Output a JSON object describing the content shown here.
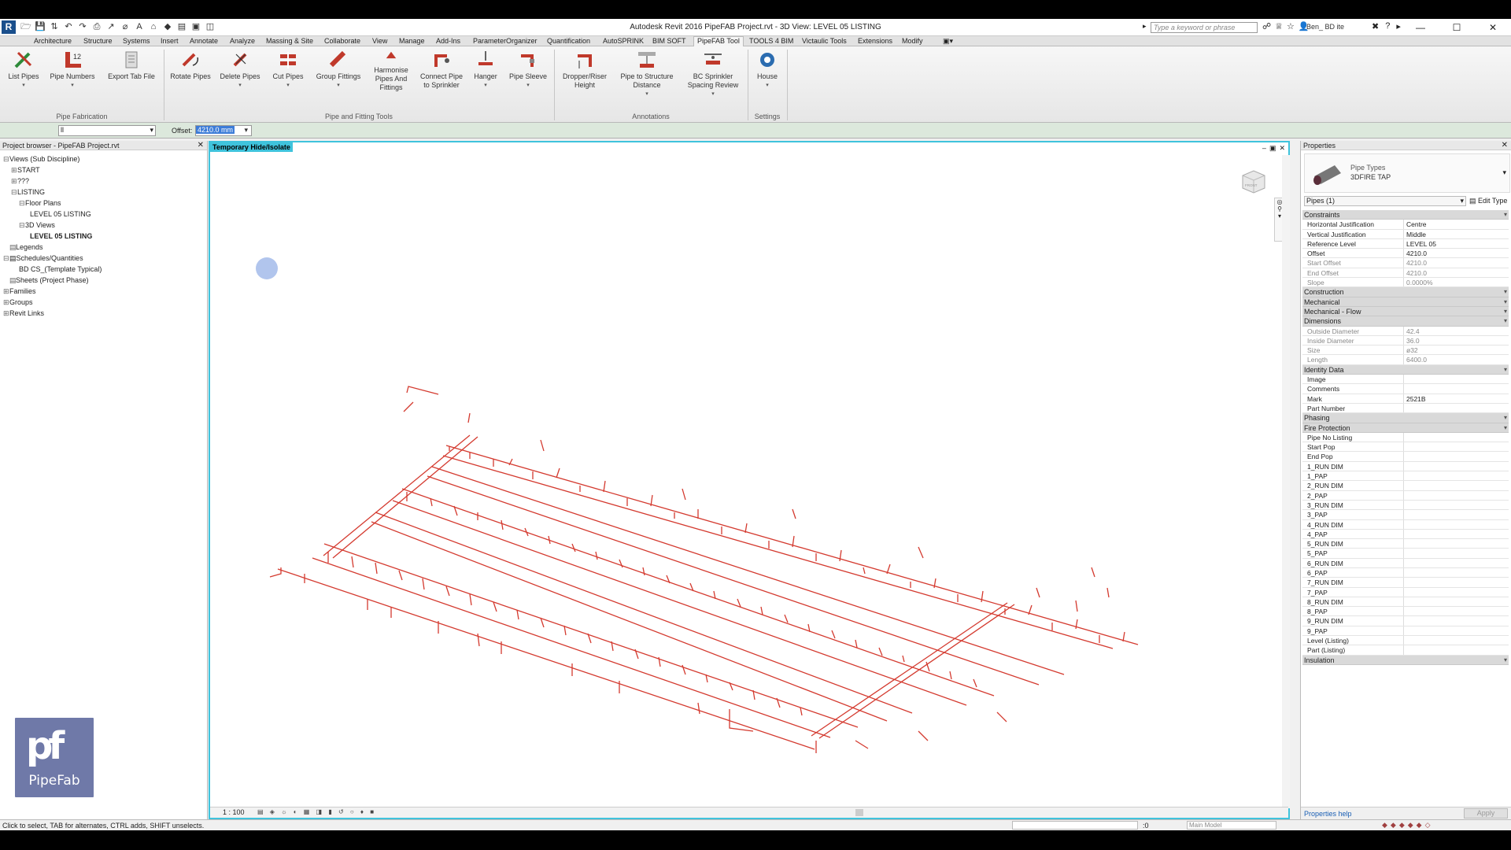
{
  "titlebar": {
    "window_title": "Autodesk Revit 2016     PipeFAB Project.rvt - 3D View: LEVEL 05 LISTING",
    "search_placeholder": "Type a keyword or phrase",
    "user_name": "Ben_ BD ite",
    "min": "—",
    "max": "☐",
    "close": "✕"
  },
  "ribbon_tabs": [
    "Architecture",
    "Structure",
    "Systems",
    "Insert",
    "Annotate",
    "Analyze",
    "Massing & Site",
    "Collaborate",
    "View",
    "Manage",
    "Add-Ins",
    "ParameterOrganizer",
    "Quantification",
    "AutoSPRINK",
    "BIM SOFT",
    "PipeFAB Tool",
    "TOOLS 4 BIM",
    "Victaulic Tools",
    "Extensions",
    "Modify"
  ],
  "active_tab": "PipeFAB Tool",
  "ribbon": {
    "buttons": [
      {
        "label": "List Pipes"
      },
      {
        "label": "Pipe Numbers"
      },
      {
        "label": "Export Tab File"
      },
      {
        "label": "Rotate Pipes"
      },
      {
        "label": "Delete Pipes"
      },
      {
        "label": "Cut Pipes"
      },
      {
        "label": "Group Fittings"
      },
      {
        "label": "Harmonise Pipes And Fittings"
      },
      {
        "label": "Connect Pipe to Sprinkler"
      },
      {
        "label": "Hanger"
      },
      {
        "label": "Pipe Sleeve"
      },
      {
        "label": "Dropper/Riser Height"
      },
      {
        "label": "Pipe to Structure Distance"
      },
      {
        "label": "BC Sprinkler Spacing Review"
      },
      {
        "label": "House"
      }
    ],
    "panels": [
      "Pipe Fabrication",
      "Pipe and Fitting Tools",
      "Annotations",
      "Settings"
    ]
  },
  "optbar": {
    "combo_value": "ll",
    "offset_label": "Offset:",
    "offset_value": "4210.0 mm"
  },
  "browser": {
    "title": "Project browser - PipeFAB Project.rvt",
    "items": [
      {
        "label": "Views (Sub Discipline)",
        "toggle": "⊟"
      },
      {
        "label": "START",
        "toggle": "⊞"
      },
      {
        "label": "???",
        "toggle": "⊞"
      },
      {
        "label": "LISTING",
        "toggle": "⊟"
      },
      {
        "label": "Floor Plans",
        "toggle": "⊟"
      },
      {
        "label": "LEVEL 05 LISTING",
        "toggle": ""
      },
      {
        "label": "3D Views",
        "toggle": "⊟"
      },
      {
        "label": "LEVEL 05 LISTING",
        "toggle": ""
      },
      {
        "label": "Legends",
        "toggle": ""
      },
      {
        "label": "Schedules/Quantities",
        "toggle": "⊟"
      },
      {
        "label": "BD CS_(Template Typical)",
        "toggle": ""
      },
      {
        "label": "Sheets (Project Phase)",
        "toggle": ""
      },
      {
        "label": "Families",
        "toggle": "⊞"
      },
      {
        "label": "Groups",
        "toggle": "⊞"
      },
      {
        "label": "Revit Links",
        "toggle": "⊞"
      }
    ]
  },
  "logo": {
    "mark": "pf",
    "word": "PipeFab"
  },
  "view": {
    "tag": "Temporary Hide/Isolate",
    "scale": "1 : 100",
    "cube_label": "FRONT"
  },
  "properties": {
    "title": "Properties",
    "type_family": "Pipe Types",
    "type_name": "3DFIRE TAP",
    "instance": "Pipes (1)",
    "edit_type": "Edit Type",
    "groups": [
      {
        "name": "Constraints",
        "rows": [
          {
            "name": "Horizontal Justification",
            "value": "Centre",
            "ro": false
          },
          {
            "name": "Vertical Justification",
            "value": "Middle",
            "ro": false
          },
          {
            "name": "Reference Level",
            "value": "LEVEL 05",
            "ro": false
          },
          {
            "name": "Offset",
            "value": "4210.0",
            "ro": false
          },
          {
            "name": "Start Offset",
            "value": "4210.0",
            "ro": true
          },
          {
            "name": "End Offset",
            "value": "4210.0",
            "ro": true
          },
          {
            "name": "Slope",
            "value": "0.0000%",
            "ro": true
          }
        ]
      },
      {
        "name": "Construction",
        "rows": []
      },
      {
        "name": "Mechanical",
        "rows": []
      },
      {
        "name": "Mechanical - Flow",
        "rows": []
      },
      {
        "name": "Dimensions",
        "rows": [
          {
            "name": "Outside Diameter",
            "value": "42.4",
            "ro": true
          },
          {
            "name": "Inside Diameter",
            "value": "36.0",
            "ro": true
          },
          {
            "name": "Size",
            "value": "ø32",
            "ro": true
          },
          {
            "name": "Length",
            "value": "6400.0",
            "ro": true
          }
        ]
      },
      {
        "name": "Identity Data",
        "rows": [
          {
            "name": "Image",
            "value": "",
            "ro": false
          },
          {
            "name": "Comments",
            "value": "",
            "ro": false
          },
          {
            "name": "Mark",
            "value": "2521B",
            "ro": false
          },
          {
            "name": "Part Number",
            "value": "",
            "ro": false
          }
        ]
      },
      {
        "name": "Phasing",
        "rows": []
      },
      {
        "name": "Fire Protection",
        "rows": [
          {
            "name": "Pipe No Listing",
            "value": "",
            "ro": false
          },
          {
            "name": "Start Pop",
            "value": "",
            "ro": false
          },
          {
            "name": "End Pop",
            "value": "",
            "ro": false
          },
          {
            "name": "1_RUN DIM",
            "value": "",
            "ro": false
          },
          {
            "name": "1_PAP",
            "value": "",
            "ro": false
          },
          {
            "name": "2_RUN DIM",
            "value": "",
            "ro": false
          },
          {
            "name": "2_PAP",
            "value": "",
            "ro": false
          },
          {
            "name": "3_RUN DIM",
            "value": "",
            "ro": false
          },
          {
            "name": "3_PAP",
            "value": "",
            "ro": false
          },
          {
            "name": "4_RUN DIM",
            "value": "",
            "ro": false
          },
          {
            "name": "4_PAP",
            "value": "",
            "ro": false
          },
          {
            "name": "5_RUN DIM",
            "value": "",
            "ro": false
          },
          {
            "name": "5_PAP",
            "value": "",
            "ro": false
          },
          {
            "name": "6_RUN DIM",
            "value": "",
            "ro": false
          },
          {
            "name": "6_PAP",
            "value": "",
            "ro": false
          },
          {
            "name": "7_RUN DIM",
            "value": "",
            "ro": false
          },
          {
            "name": "7_PAP",
            "value": "",
            "ro": false
          },
          {
            "name": "8_RUN DIM",
            "value": "",
            "ro": false
          },
          {
            "name": "8_PAP",
            "value": "",
            "ro": false
          },
          {
            "name": "9_RUN DIM",
            "value": "",
            "ro": false
          },
          {
            "name": "9_PAP",
            "value": "",
            "ro": false
          },
          {
            "name": "Level (Listing)",
            "value": "",
            "ro": false
          },
          {
            "name": "Part (Listing)",
            "value": "",
            "ro": false
          }
        ]
      },
      {
        "name": "Insulation",
        "rows": []
      }
    ],
    "help": "Properties help",
    "apply": "Apply"
  },
  "statusbar": {
    "text": "Click to select, TAB for alternates, CTRL adds, SHIFT unselects.",
    "zero": ":0",
    "model": "Main Model"
  },
  "colors": {
    "pipe": "#d43a2f",
    "view_border": "#3fc3dc",
    "logo_bg": "#6f79a8"
  }
}
